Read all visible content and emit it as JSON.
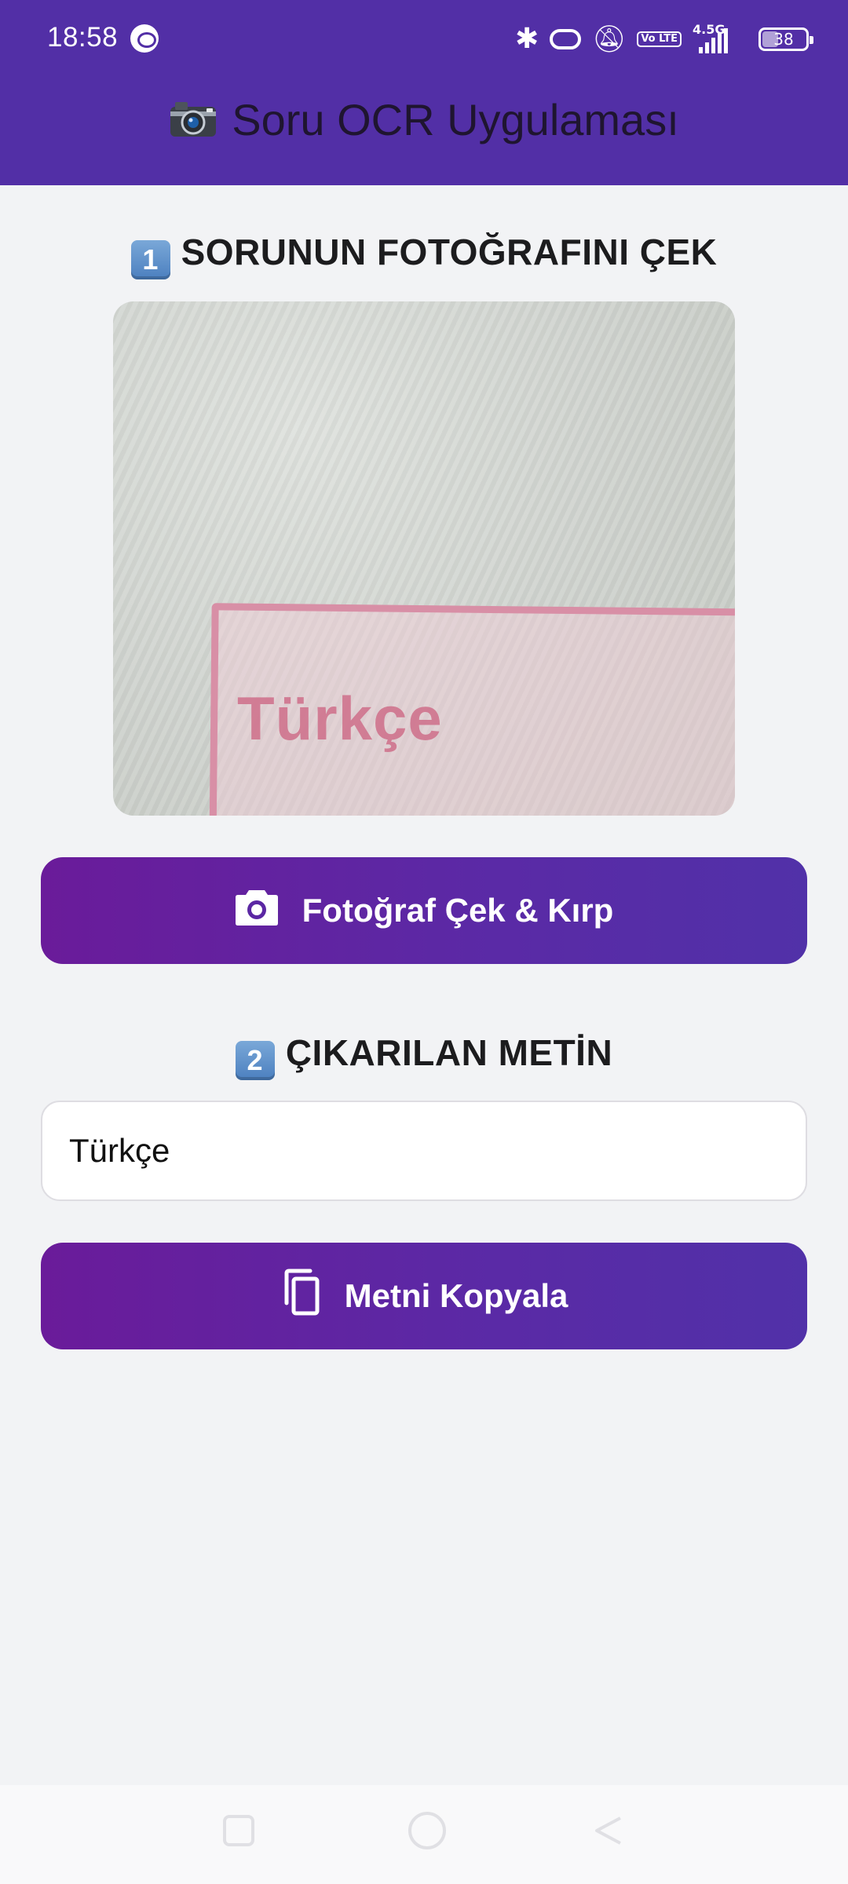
{
  "status_bar": {
    "time": "18:58",
    "network": "4.5G",
    "volte": "Vo LTE",
    "battery": "38",
    "icons": [
      "sync-icon",
      "bluetooth-icon",
      "link-icon",
      "bell-muted-icon",
      "volte-icon",
      "signal-icon",
      "battery-icon"
    ]
  },
  "app_bar": {
    "title": "Soru OCR Uygulaması",
    "title_icon": "camera-emoji-icon"
  },
  "section1": {
    "number": "1",
    "title": "SORUNUN FOTOĞRAFINI ÇEK",
    "photo_text": "Türkçe"
  },
  "capture_button": {
    "label": "Fotoğraf Çek & Kırp",
    "icon": "camera-icon"
  },
  "section2": {
    "number": "2",
    "title": "ÇIKARILAN METİN"
  },
  "extracted_text": {
    "value": "Türkçe"
  },
  "copy_button": {
    "label": "Metni Kopyala",
    "icon": "copy-icon"
  },
  "colors": {
    "primary": "#522FA6",
    "button_gradient_start": "#6A1B9A",
    "button_gradient_end": "#5131A8",
    "background": "#F2F3F5"
  }
}
